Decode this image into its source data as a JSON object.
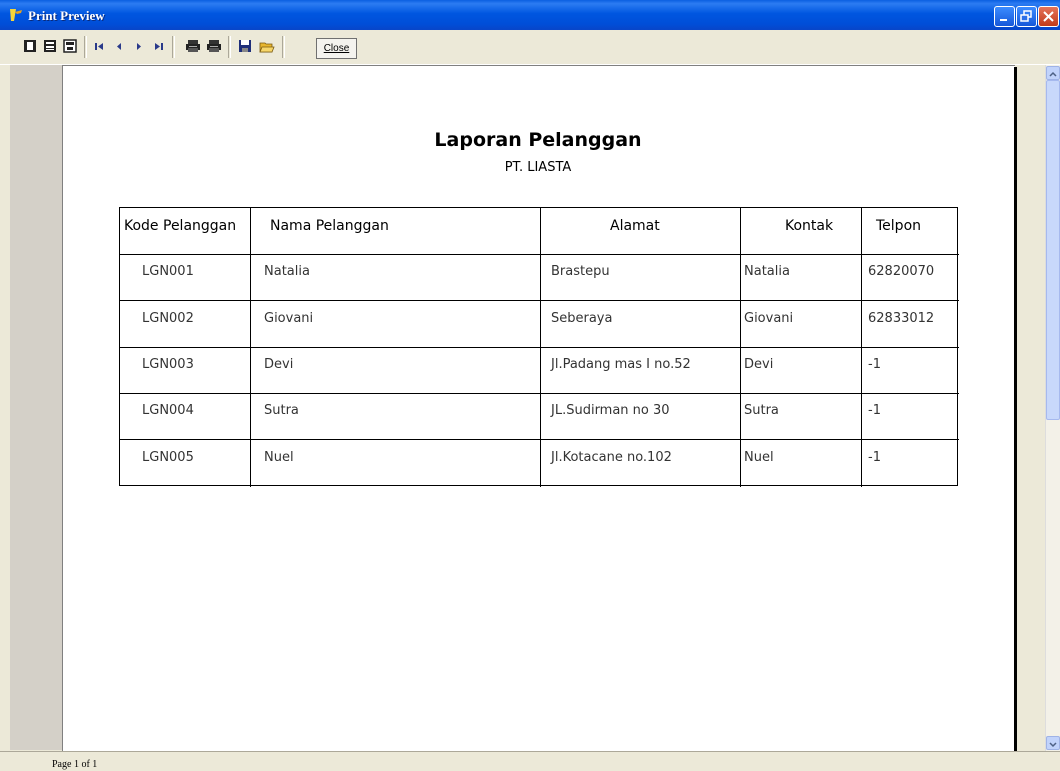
{
  "window": {
    "title": "Print Preview",
    "colors": {
      "titlebar": "#0054E3",
      "close": "#D7492A",
      "face": "#ECE9D8"
    }
  },
  "toolbar": {
    "buttons": [
      {
        "icon": "one-page-icon"
      },
      {
        "icon": "two-pages-icon"
      },
      {
        "icon": "fit-page-icon"
      },
      {
        "icon": "first-page-icon"
      },
      {
        "icon": "prev-page-icon"
      },
      {
        "icon": "next-page-icon"
      },
      {
        "icon": "last-page-icon"
      },
      {
        "icon": "print-setup-icon"
      },
      {
        "icon": "print-icon"
      },
      {
        "icon": "save-icon"
      },
      {
        "icon": "open-icon"
      }
    ],
    "close_label": "Close"
  },
  "report": {
    "title": "Laporan Pelanggan",
    "subtitle": "PT. LIASTA",
    "columns": [
      "Kode Pelanggan",
      "Nama Pelanggan",
      "Alamat",
      "Kontak",
      "Telpon"
    ],
    "rows": [
      [
        "LGN001",
        "Natalia",
        "Brastepu",
        "Natalia",
        "62820070"
      ],
      [
        "LGN002",
        "Giovani",
        "Seberaya",
        "Giovani",
        "62833012"
      ],
      [
        "LGN003",
        "Devi",
        "Jl.Padang mas I no.52",
        "Devi",
        "-1"
      ],
      [
        "LGN004",
        "Sutra",
        "JL.Sudirman no 30",
        "Sutra",
        "-1"
      ],
      [
        "LGN005",
        "Nuel",
        "Jl.Kotacane no.102",
        "Nuel",
        "-1"
      ]
    ]
  },
  "status": {
    "page": "Page 1 of 1"
  }
}
